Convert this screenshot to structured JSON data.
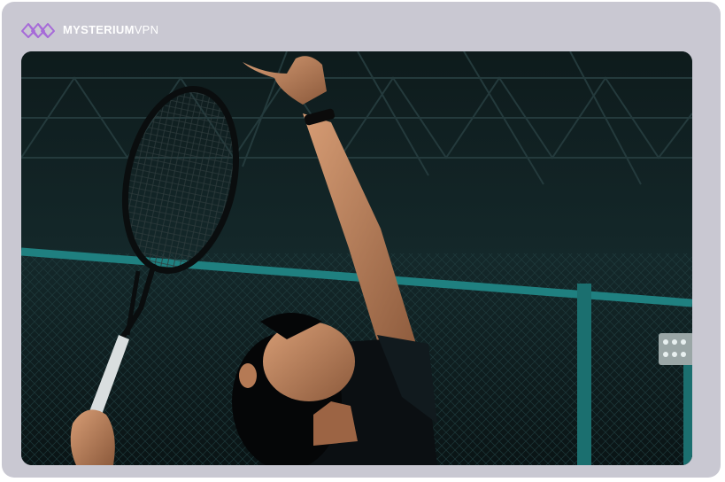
{
  "brand": {
    "name_strong": "MYSTERIUM",
    "name_light": "VPN",
    "logo_icon": "mysterium-logo-icon",
    "accent_color": "#a66ad8"
  },
  "photo": {
    "subject": "tennis-player-serving",
    "frame_color": "#c9c8d2",
    "dominant_color": "#0d1a1c"
  }
}
